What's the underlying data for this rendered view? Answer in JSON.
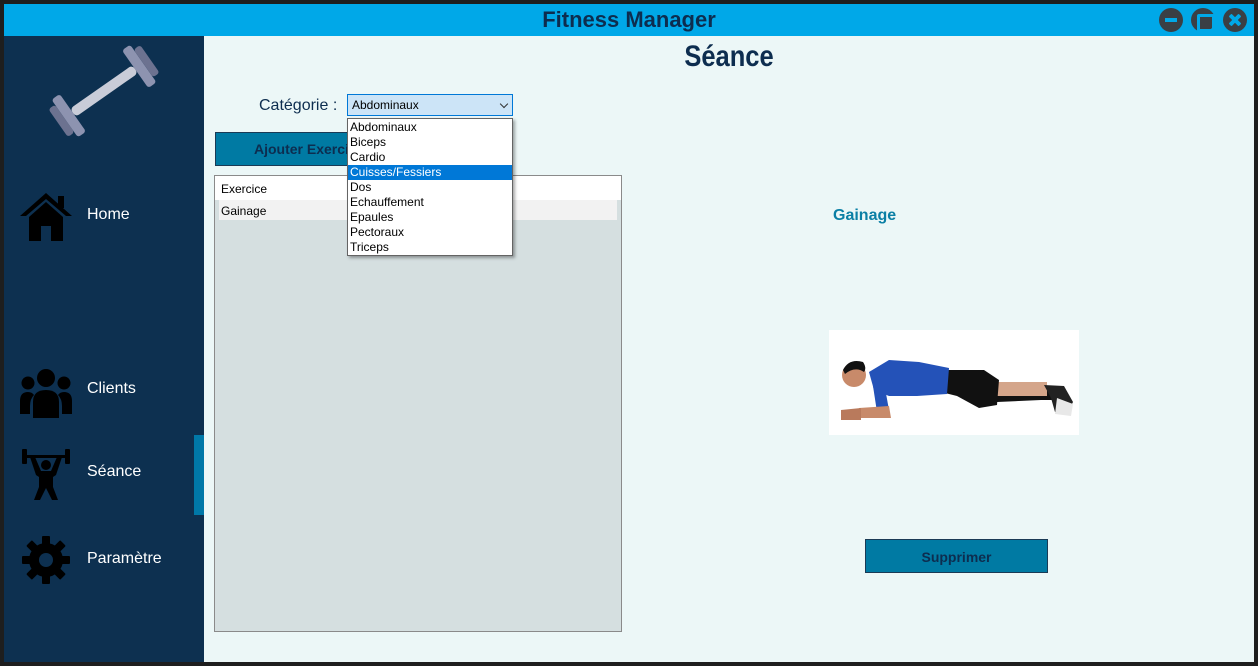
{
  "window": {
    "title": "Fitness Manager"
  },
  "sidebar": {
    "items": [
      {
        "label": "Home",
        "icon": "home-icon"
      },
      {
        "label": "Clients",
        "icon": "users-icon"
      },
      {
        "label": "Séance",
        "icon": "weightlifter-icon",
        "active": true
      },
      {
        "label": "Paramètre",
        "icon": "gear-icon"
      }
    ]
  },
  "main": {
    "title": "Séance",
    "category_label": "Catégorie :",
    "category_value": "Abdominaux",
    "category_options": [
      "Abdominaux",
      "Biceps",
      "Cardio",
      "Cuisses/Fessiers",
      "Dos",
      "Echauffement",
      "Epaules",
      "Pectoraux",
      "Triceps"
    ],
    "highlighted_option": "Cuisses/Fessiers",
    "add_button_label": "Ajouter Exercice",
    "list": {
      "header": "Exercice",
      "rows": [
        "Gainage"
      ]
    },
    "selected_exercise": "Gainage",
    "delete_button_label": "Supprimer"
  },
  "colors": {
    "titlebar": "#00a8e8",
    "sidebar": "#0d3050",
    "content_bg": "#ecf7f7",
    "button": "#007aa3",
    "accent_text": "#0a7fa5"
  }
}
